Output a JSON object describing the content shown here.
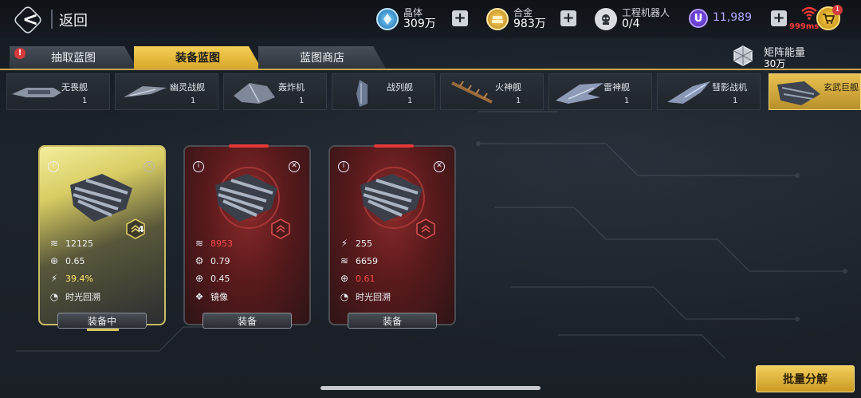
{
  "header": {
    "back_label": "返回",
    "resources": [
      {
        "name": "晶体",
        "value": "309万",
        "icon": "crystal-icon"
      },
      {
        "name": "合金",
        "value": "983万",
        "icon": "alloy-icon"
      },
      {
        "name": "工程机器人",
        "value": "0/4",
        "icon": "robot-icon"
      }
    ],
    "premium": {
      "badge": "U",
      "value": "11,989"
    },
    "ping": "999ms",
    "cart_badge": "1"
  },
  "tabs": [
    {
      "label": "抽取蓝图",
      "active": false,
      "alert": "!"
    },
    {
      "label": "装备蓝图",
      "active": true
    },
    {
      "label": "蓝图商店",
      "active": false
    }
  ],
  "matrix": {
    "name": "矩阵能量",
    "value": "30万"
  },
  "ship_types": [
    {
      "name": "无畏舰",
      "count": "1",
      "selected": false
    },
    {
      "name": "幽灵战舰",
      "count": "1",
      "selected": false
    },
    {
      "name": "轰炸机",
      "count": "1",
      "selected": false
    },
    {
      "name": "战列舰",
      "count": "1",
      "selected": false
    },
    {
      "name": "火神舰",
      "count": "1",
      "selected": false
    },
    {
      "name": "雷神舰",
      "count": "1",
      "selected": false
    },
    {
      "name": "彗影战机",
      "count": "1",
      "selected": false
    },
    {
      "name": "玄武巨舰",
      "count": "",
      "selected": true
    }
  ],
  "cards": [
    {
      "style": "gold",
      "rank": "4",
      "stats": [
        {
          "icon": "armor-icon",
          "value": "12125",
          "color": "white"
        },
        {
          "icon": "crosshair-icon",
          "value": "0.65",
          "color": "white"
        },
        {
          "icon": "damage-icon",
          "value": "39.4%",
          "color": "yellow"
        },
        {
          "icon": "time-rewind-icon",
          "value": "时光回溯",
          "color": "white"
        }
      ],
      "button": "装备中"
    },
    {
      "style": "red",
      "rank": "",
      "stats": [
        {
          "icon": "armor-icon",
          "value": "8953",
          "color": "red"
        },
        {
          "icon": "gear-icon",
          "value": "0.79",
          "color": "white"
        },
        {
          "icon": "crosshair-icon",
          "value": "0.45",
          "color": "white"
        },
        {
          "icon": "mirror-icon",
          "value": "镜像",
          "color": "white"
        }
      ],
      "button": "装备"
    },
    {
      "style": "red",
      "rank": "",
      "stats": [
        {
          "icon": "damage-icon",
          "value": "255",
          "color": "white"
        },
        {
          "icon": "armor-icon",
          "value": "6659",
          "color": "white"
        },
        {
          "icon": "crosshair-icon",
          "value": "0.61",
          "color": "red"
        },
        {
          "icon": "time-rewind-icon",
          "value": "时光回溯",
          "color": "white"
        }
      ],
      "button": "装备"
    }
  ],
  "footer": {
    "bulk_label": "批量分解"
  },
  "colors": {
    "gold": "#e9c14f",
    "red": "#5a1a1c",
    "accent_purple": "#8a5cff"
  }
}
